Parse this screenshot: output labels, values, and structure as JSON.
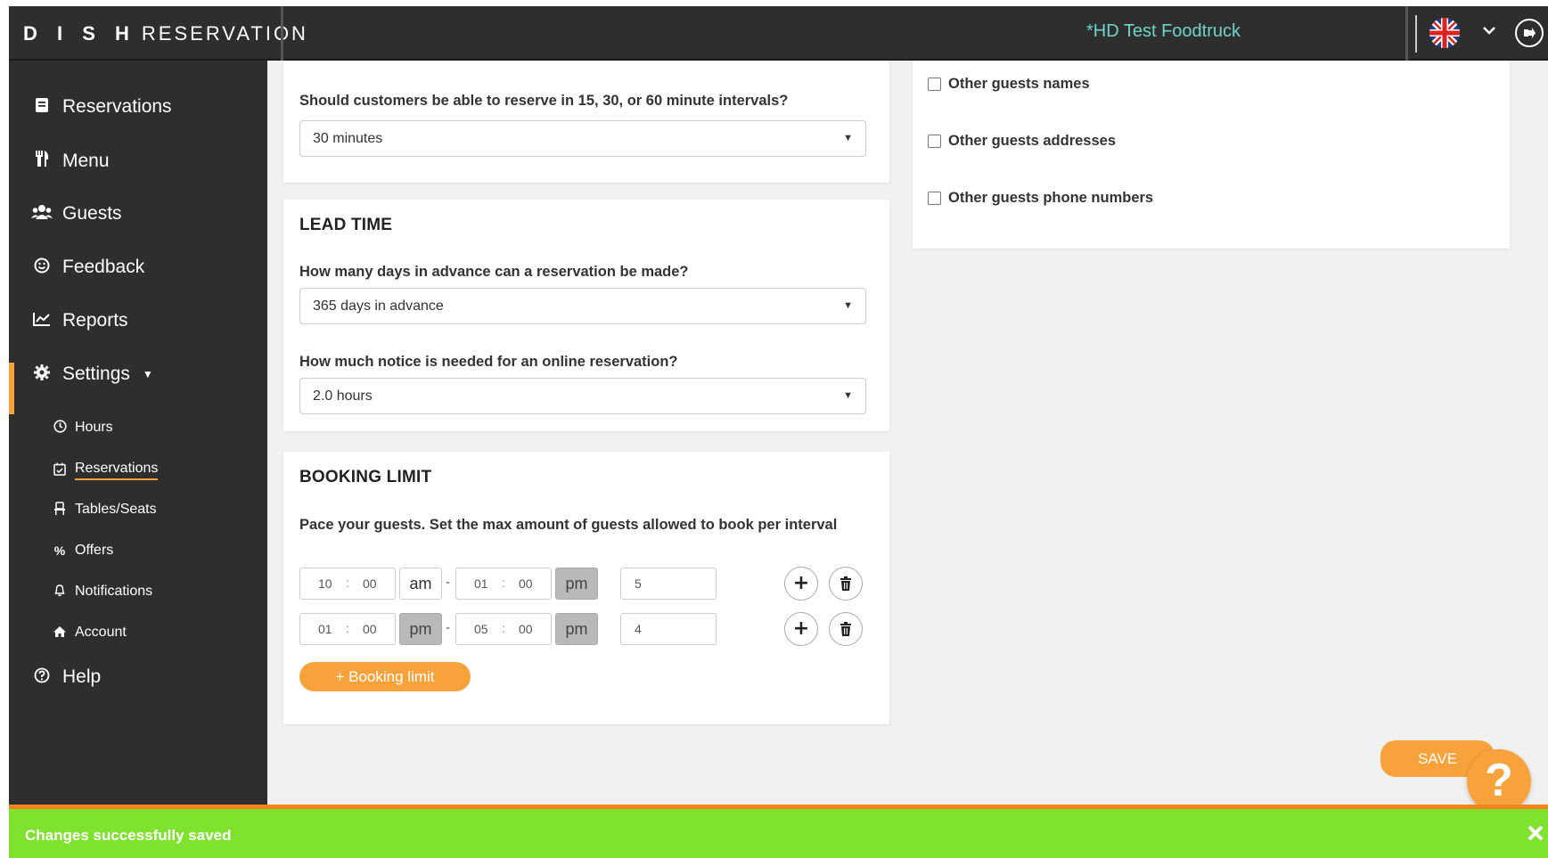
{
  "header": {
    "logo_bold": "D I S H",
    "logo_rest": "RESERVATION",
    "restaurant_name": "*HD Test Foodtruck"
  },
  "sidebar": {
    "items": [
      {
        "label": "Reservations",
        "icon": "book-icon"
      },
      {
        "label": "Menu",
        "icon": "cutlery-icon"
      },
      {
        "label": "Guests",
        "icon": "users-icon"
      },
      {
        "label": "Feedback",
        "icon": "smiley-icon"
      },
      {
        "label": "Reports",
        "icon": "chart-icon"
      },
      {
        "label": "Settings",
        "icon": "gear-icon"
      },
      {
        "label": "Help",
        "icon": "question-icon"
      }
    ],
    "settings_sub": [
      {
        "label": "Hours",
        "icon": "clock-icon"
      },
      {
        "label": "Reservations",
        "icon": "calendar-check-icon"
      },
      {
        "label": "Tables/Seats",
        "icon": "chair-icon"
      },
      {
        "label": "Offers",
        "icon": "percent-icon"
      },
      {
        "label": "Notifications",
        "icon": "bell-icon"
      },
      {
        "label": "Account",
        "icon": "home-icon"
      }
    ]
  },
  "interval": {
    "question": "Should customers be able to reserve in 15, 30, or 60 minute intervals?",
    "value": "30 minutes"
  },
  "lead_time": {
    "heading": "LEAD TIME",
    "advance_question": "How many days in advance can a reservation be made?",
    "advance_value": "365 days in advance",
    "notice_question": "How much notice is needed for an online reservation?",
    "notice_value": "2.0 hours"
  },
  "booking_limit": {
    "heading": "BOOKING LIMIT",
    "description": "Pace your guests. Set the max amount of guests allowed to book per interval",
    "rows": [
      {
        "from_h": "10",
        "from_m": "00",
        "from_ampm": "am",
        "to_h": "01",
        "to_m": "00",
        "to_ampm": "pm",
        "guests": "5"
      },
      {
        "from_h": "01",
        "from_m": "00",
        "from_ampm": "pm",
        "to_h": "05",
        "to_m": "00",
        "to_ampm": "pm",
        "guests": "4"
      }
    ],
    "add_label": "+ Booking limit"
  },
  "guest_info": {
    "options": [
      "Other guests names",
      "Other guests addresses",
      "Other guests phone numbers"
    ]
  },
  "save_label": "SAVE",
  "toast": {
    "message": "Changes successfully saved"
  },
  "colors": {
    "accent": "#f7a23b",
    "sidebar_bg": "#2e2e2e",
    "toast_bg": "#7fe22e",
    "restaurant_text": "#6fd4c6"
  }
}
